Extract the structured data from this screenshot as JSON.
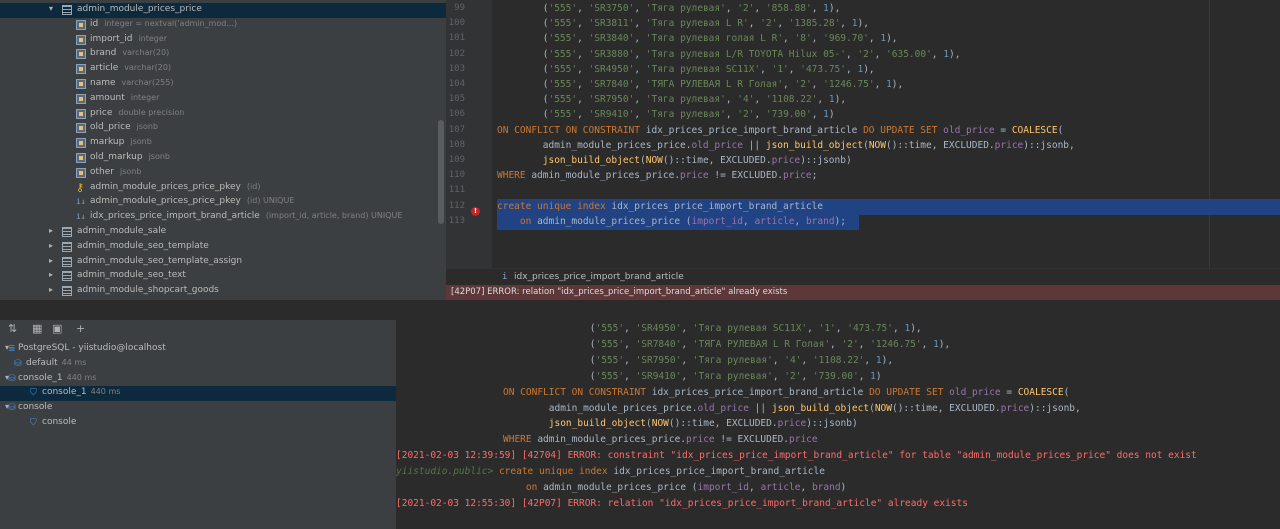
{
  "tree": {
    "items": [
      {
        "label": "admin_module_prices_price",
        "type": "",
        "kind": "table",
        "expanded": true,
        "selected": true
      },
      {
        "label": "id",
        "type": "integer = nextval('admin_mod...)",
        "kind": "column"
      },
      {
        "label": "import_id",
        "type": "integer",
        "kind": "column"
      },
      {
        "label": "brand",
        "type": "varchar(20)",
        "kind": "column"
      },
      {
        "label": "article",
        "type": "varchar(20)",
        "kind": "column"
      },
      {
        "label": "name",
        "type": "varchar(255)",
        "kind": "column"
      },
      {
        "label": "amount",
        "type": "integer",
        "kind": "column"
      },
      {
        "label": "price",
        "type": "double precision",
        "kind": "column"
      },
      {
        "label": "old_price",
        "type": "jsonb",
        "kind": "column"
      },
      {
        "label": "markup",
        "type": "jsonb",
        "kind": "column"
      },
      {
        "label": "old_markup",
        "type": "jsonb",
        "kind": "column"
      },
      {
        "label": "other",
        "type": "jsonb",
        "kind": "column"
      },
      {
        "label": "admin_module_prices_price_pkey",
        "type": "(id)",
        "kind": "key"
      },
      {
        "label": "admin_module_prices_price_pkey",
        "type": "(id) UNIQUE",
        "kind": "index"
      },
      {
        "label": "idx_prices_price_import_brand_article",
        "type": "(import_id, article, brand) UNIQUE",
        "kind": "index"
      },
      {
        "label": "admin_module_sale",
        "type": "",
        "kind": "table"
      },
      {
        "label": "admin_module_seo_template",
        "type": "",
        "kind": "table"
      },
      {
        "label": "admin_module_seo_template_assign",
        "type": "",
        "kind": "table"
      },
      {
        "label": "admin_module_seo_text",
        "type": "",
        "kind": "table"
      },
      {
        "label": "admin_module_shopcart_goods",
        "type": "",
        "kind": "table"
      }
    ]
  },
  "editor": {
    "lines": [
      {
        "num": "99",
        "text": "        ('555', 'SR3750', 'Тяга рулевая', '2', '858.88', 1),"
      },
      {
        "num": "100",
        "text": "        ('555', 'SR3811', 'Тяга рулевая L R', '2', '1385.28', 1),"
      },
      {
        "num": "101",
        "text": "        ('555', 'SR3840', 'Тяга рулевая голая L R', '8', '969.70', 1),"
      },
      {
        "num": "102",
        "text": "        ('555', 'SR3880', 'Тяга рулевая L/R TOYOTA Hilux 05-', '2', '635.00', 1),"
      },
      {
        "num": "103",
        "text": "        ('555', 'SR4950', 'Тяга рулевая SC11X', '1', '473.75', 1),"
      },
      {
        "num": "104",
        "text": "        ('555', 'SR7840', 'ТЯГА РУЛЕВАЯ L R Голая', '2', '1246.75', 1),"
      },
      {
        "num": "105",
        "text": "        ('555', 'SR7950', 'Тяга рулевая', '4', '1108.22', 1),"
      },
      {
        "num": "106",
        "text": "        ('555', 'SR9410', 'Тяга рулевая', '2', '739.00', 1)"
      },
      {
        "num": "107",
        "text": "ON CONFLICT ON CONSTRAINT idx_prices_price_import_brand_article DO UPDATE SET old_price = COALESCE("
      },
      {
        "num": "108",
        "text": "        admin_module_prices_price.old_price || json_build_object(NOW()::time, EXCLUDED.price)::jsonb,"
      },
      {
        "num": "109",
        "text": "        json_build_object(NOW()::time, EXCLUDED.price)::jsonb)"
      },
      {
        "num": "110",
        "text": "WHERE admin_module_prices_price.price != EXCLUDED.price;"
      },
      {
        "num": "111",
        "text": ""
      },
      {
        "num": "112",
        "text": "create unique index idx_prices_price_import_brand_article"
      },
      {
        "num": "113",
        "text": "    on admin_module_prices_price (import_id, article, brand);"
      }
    ],
    "hint": "idx_prices_price_import_brand_article",
    "error_bar": "[42P07] ERROR: relation \"idx_prices_price_import_brand_article\" already exists"
  },
  "services": {
    "items": [
      {
        "label": "PostgreSQL - yiistudio@localhost",
        "dim": ""
      },
      {
        "label": "default",
        "dim": "44 ms"
      },
      {
        "label": "console_1",
        "dim": "440 ms"
      },
      {
        "label": "console_1",
        "dim": "440 ms"
      },
      {
        "label": "console",
        "dim": ""
      },
      {
        "label": "console",
        "dim": ""
      }
    ]
  },
  "console": {
    "lines": [
      {
        "text": "        ('555', 'SR4950', 'Тяга рулевая SC11X', '1', '473.75', 1),",
        "kind": "normal"
      },
      {
        "text": "        ('555', 'SR7840', 'ТЯГА РУЛЕВАЯ L R Голая', '2', '1246.75', 1),",
        "kind": "normal"
      },
      {
        "text": "        ('555', 'SR7950', 'Тяга рулевая', '4', '1108.22', 1),",
        "kind": "normal"
      },
      {
        "text": "        ('555', 'SR9410', 'Тяга рулевая', '2', '739.00', 1)",
        "kind": "normal"
      },
      {
        "text": "ON CONFLICT ON CONSTRAINT idx_prices_price_import_brand_article DO UPDATE SET old_price = COALESCE(",
        "kind": "normal"
      },
      {
        "text": "        admin_module_prices_price.old_price || json_build_object(NOW()::time, EXCLUDED.price)::jsonb,",
        "kind": "normal"
      },
      {
        "text": "        json_build_object(NOW()::time, EXCLUDED.price)::jsonb)",
        "kind": "normal"
      },
      {
        "text": "WHERE admin_module_prices_price.price != EXCLUDED.price",
        "kind": "normal"
      },
      {
        "text": "[2021-02-03 12:39:59] [42704] ERROR: constraint \"idx_prices_price_import_brand_article\" for table \"admin_module_prices_price\" does not exist",
        "kind": "error"
      },
      {
        "text": "create unique index idx_prices_price_import_brand_article",
        "kind": "prompt",
        "prompt": "yiistudio.public>"
      },
      {
        "text": "    on admin_module_prices_price (import_id, article, brand)",
        "kind": "normal"
      },
      {
        "text": "[2021-02-03 12:55:30] [42P07] ERROR: relation \"idx_prices_price_import_brand_article\" already exists",
        "kind": "error"
      }
    ]
  },
  "colors": {
    "error": "#ff6b68",
    "selection": "#214283",
    "keyword": "#cc7832",
    "string": "#6a8759"
  }
}
